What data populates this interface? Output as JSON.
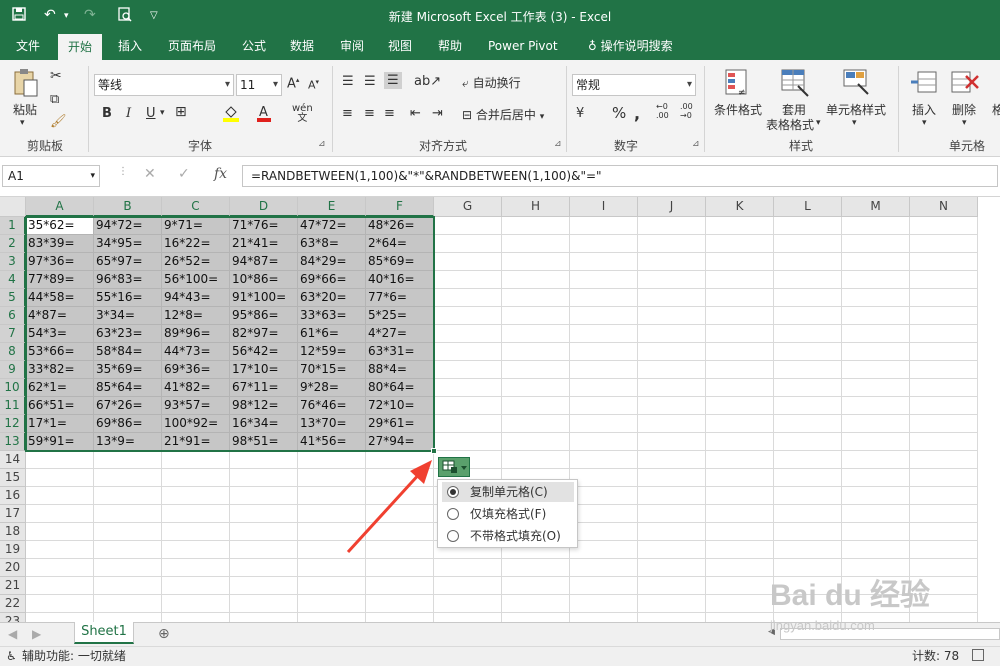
{
  "window": {
    "title": "新建 Microsoft Excel 工作表 (3)  -  Excel"
  },
  "ribbon_tabs": [
    "文件",
    "开始",
    "插入",
    "页面布局",
    "公式",
    "数据",
    "审阅",
    "视图",
    "帮助",
    "Power Pivot",
    "操作说明搜索"
  ],
  "clipboard": {
    "paste": "粘贴",
    "label": "剪贴板"
  },
  "font": {
    "name": "等线",
    "size": "11",
    "label": "字体",
    "bold": "B",
    "italic": "I",
    "underline": "U"
  },
  "alignment": {
    "wrap": "自动换行",
    "merge": "合并后居中",
    "label": "对齐方式"
  },
  "number": {
    "format": "常规",
    "label": "数字",
    "percent": "%"
  },
  "styles": {
    "conditional": "条件格式",
    "table_line1": "套用",
    "table_line2": "表格格式",
    "cell_styles": "单元格样式",
    "label": "样式"
  },
  "cells_group": {
    "insert": "插入",
    "delete": "删除",
    "label": "单元格"
  },
  "namebox": "A1",
  "fx": "fx",
  "formula": "=RANDBETWEEN(1,100)&\"*\"&RANDBETWEEN(1,100)&\"=\"",
  "columns": [
    "A",
    "B",
    "C",
    "D",
    "E",
    "F",
    "G",
    "H",
    "I",
    "J",
    "K",
    "L",
    "M",
    "N"
  ],
  "rows": [
    "1",
    "2",
    "3",
    "4",
    "5",
    "6",
    "7",
    "8",
    "9",
    "10",
    "11",
    "12",
    "13",
    "14",
    "15",
    "16",
    "17",
    "18",
    "19",
    "20",
    "21",
    "22",
    "23"
  ],
  "cells": [
    [
      "35*62=",
      "94*72=",
      "9*71=",
      "71*76=",
      "47*72=",
      "48*26="
    ],
    [
      "83*39=",
      "34*95=",
      "16*22=",
      "21*41=",
      "63*8=",
      "2*64="
    ],
    [
      "97*36=",
      "65*97=",
      "26*52=",
      "94*87=",
      "84*29=",
      "85*69="
    ],
    [
      "77*89=",
      "96*83=",
      "56*100=",
      "10*86=",
      "69*66=",
      "40*16="
    ],
    [
      "44*58=",
      "55*16=",
      "94*43=",
      "91*100=",
      "63*20=",
      "77*6="
    ],
    [
      "4*87=",
      "3*34=",
      "12*8=",
      "95*86=",
      "33*63=",
      "5*25="
    ],
    [
      "54*3=",
      "63*23=",
      "89*96=",
      "82*97=",
      "61*6=",
      "4*27="
    ],
    [
      "53*66=",
      "58*84=",
      "44*73=",
      "56*42=",
      "12*59=",
      "63*31="
    ],
    [
      "33*82=",
      "35*69=",
      "69*36=",
      "17*10=",
      "70*15=",
      "88*4="
    ],
    [
      "62*1=",
      "85*64=",
      "41*82=",
      "67*11=",
      "9*28=",
      "80*64="
    ],
    [
      "66*51=",
      "67*26=",
      "93*57=",
      "98*12=",
      "76*46=",
      "72*10="
    ],
    [
      "17*1=",
      "69*86=",
      "100*92=",
      "16*34=",
      "13*70=",
      "29*61="
    ],
    [
      "59*91=",
      "13*9=",
      "21*91=",
      "98*51=",
      "41*56=",
      "27*94="
    ]
  ],
  "autofill_options": [
    "复制单元格(C)",
    "仅填充格式(F)",
    "不带格式填充(O)"
  ],
  "sheet_tab": "Sheet1",
  "status": {
    "accessibility": "辅助功能: 一切就绪",
    "count": "计数: 78"
  },
  "watermark": {
    "main": "Bai du 经验",
    "sub": "jingyan.baidu.com"
  }
}
